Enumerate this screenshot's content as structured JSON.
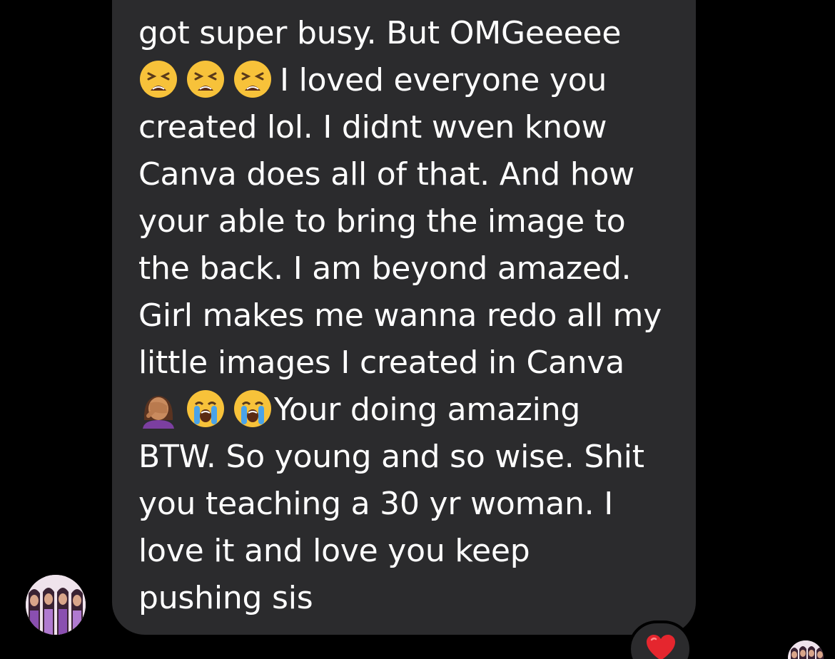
{
  "message": {
    "lines": [
      "got super busy. But OMGeeeee",
      "I loved everyone you",
      "created lol. I didnt wven know",
      "Canva does all of that. And how",
      "your able to bring the image to",
      "the back. I am beyond amazed.",
      "Girl makes me wanna redo all my",
      "little images I created in Canva",
      "Your doing amazing",
      "BTW. So young and so wise. Shit",
      "you teaching a 30 yr woman. I",
      "love it and love you keep",
      "pushing sis"
    ],
    "emojis_line2": [
      "tired-face-emoji",
      "tired-face-emoji",
      "tired-face-emoji"
    ],
    "emojis_line9": [
      "facepalm-emoji",
      "crying-face-emoji",
      "crying-face-emoji"
    ]
  },
  "reaction": {
    "icon": "red-heart-icon",
    "color": "#e5262e"
  },
  "colors": {
    "background": "#000000",
    "bubble": "#2b2b2d",
    "text": "#ffffff"
  }
}
